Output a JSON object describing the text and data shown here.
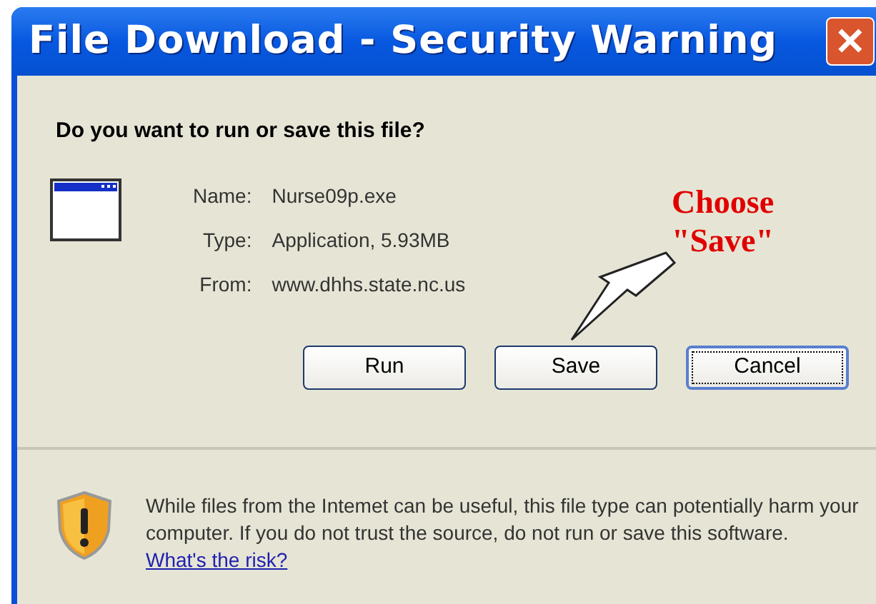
{
  "window": {
    "title": "File Download - Security Warning",
    "close_glyph": "✕"
  },
  "question": "Do you want to run or save this file?",
  "fields": [
    {
      "label": "Name:",
      "value": "Nurse09p.exe"
    },
    {
      "label": "Type:",
      "value": "Application, 5.93MB"
    },
    {
      "label": "From:",
      "value": "www.dhhs.state.nc.us"
    }
  ],
  "buttons": [
    {
      "label": "Run",
      "focused": false
    },
    {
      "label": "Save",
      "focused": false
    },
    {
      "label": "Cancel",
      "focused": true
    }
  ],
  "annotation": {
    "lines": [
      "Choose",
      "\"Save\""
    ]
  },
  "warning": {
    "text": "While files from the Intemet can be useful, this file type can potentially harm your computer. If you do not trust the source, do not run or save this software.",
    "link": "What's the risk?"
  }
}
